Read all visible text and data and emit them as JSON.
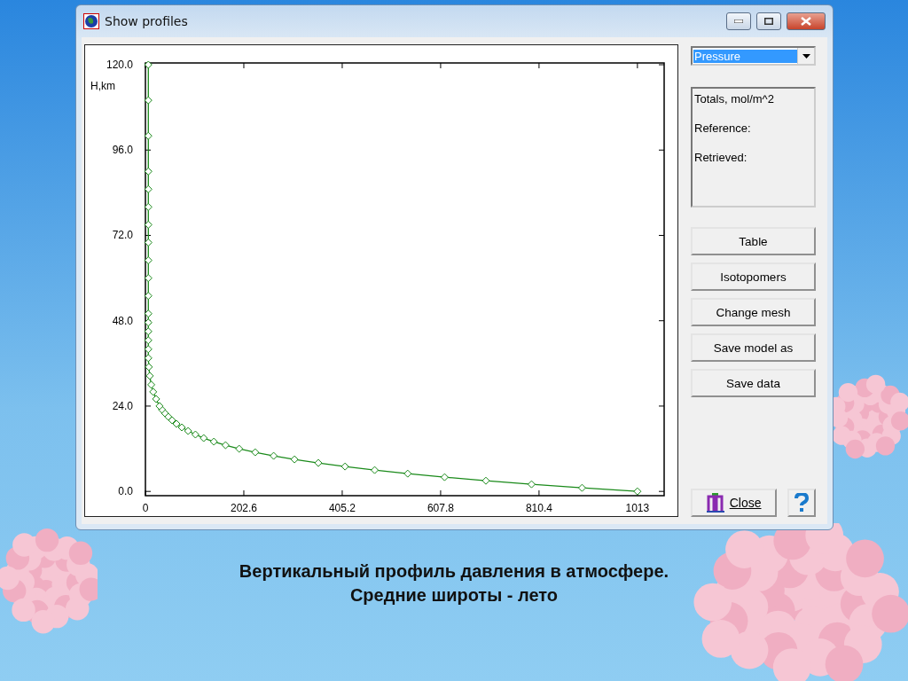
{
  "window": {
    "title": "Show profiles"
  },
  "plot": {
    "chart_data": {
      "type": "line",
      "ylabel": "H,km",
      "xlim": [
        0,
        1068
      ],
      "ylim": [
        -1.2,
        120.5
      ],
      "xticks": [
        0,
        202.6,
        405.2,
        607.8,
        810.4,
        1013
      ],
      "yticks": [
        {
          "value": 0,
          "label": "0.0"
        },
        {
          "value": 24,
          "label": "24.0"
        },
        {
          "value": 48,
          "label": "48.0"
        },
        {
          "value": 72,
          "label": "72.0"
        },
        {
          "value": 96,
          "label": "96.0"
        },
        {
          "value": 120,
          "label": "120.0"
        }
      ],
      "x": [
        1013,
        899,
        795,
        701,
        616,
        540,
        472,
        411,
        356,
        307,
        264,
        226,
        193,
        165,
        141,
        120,
        103,
        88,
        75,
        64,
        55,
        47,
        40,
        34,
        29,
        22,
        16,
        12,
        9,
        7,
        6,
        6,
        6,
        6,
        6,
        6,
        6,
        6,
        6,
        6,
        6,
        6,
        6,
        6,
        6,
        6,
        6
      ],
      "series": [
        {
          "color": "#1a8a1a",
          "marker": "diamond",
          "values": [
            0,
            1,
            2,
            3,
            4,
            5,
            6,
            7,
            8,
            9,
            10,
            11,
            12,
            13,
            14,
            15,
            16,
            17,
            18,
            19,
            20,
            21,
            22,
            23,
            24,
            26,
            28,
            30,
            32.5,
            35,
            37.5,
            40,
            42.5,
            45,
            47.5,
            50,
            55,
            60,
            65,
            70,
            75,
            80,
            85,
            90,
            100,
            110,
            120
          ]
        }
      ]
    }
  },
  "parameter_select": {
    "value": "Pressure"
  },
  "totals": {
    "title": "Totals, mol/m^2",
    "lines": [
      "Reference:",
      "Retrieved:"
    ]
  },
  "buttons": [
    "Table",
    "Isotopomers",
    "Change mesh",
    "Save model as",
    "Save data"
  ],
  "close_button": {
    "label": "Close"
  },
  "caption": [
    "Вертикальный профиль давления в атмосфере.",
    "Средние широты - лето"
  ]
}
